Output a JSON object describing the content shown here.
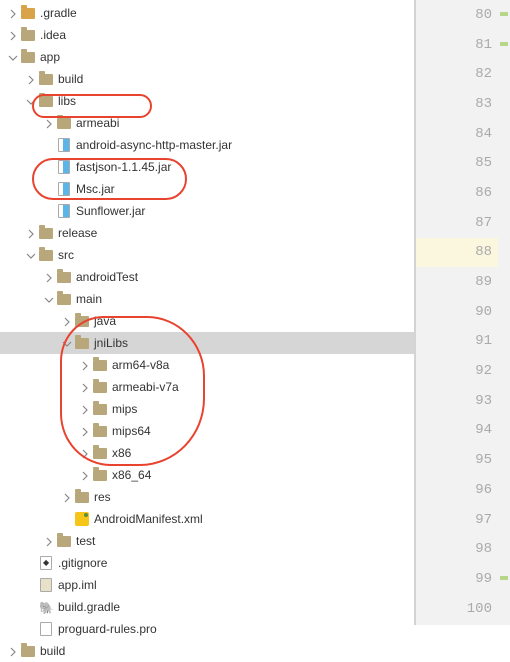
{
  "tree": [
    {
      "depth": 0,
      "arrow": "right",
      "icon": "folder-orange",
      "label": ".gradle"
    },
    {
      "depth": 0,
      "arrow": "right",
      "icon": "folder",
      "label": ".idea"
    },
    {
      "depth": 0,
      "arrow": "down",
      "icon": "folder",
      "label": "app"
    },
    {
      "depth": 1,
      "arrow": "right",
      "icon": "folder",
      "label": "build"
    },
    {
      "depth": 1,
      "arrow": "down",
      "icon": "folder",
      "label": "libs"
    },
    {
      "depth": 2,
      "arrow": "right",
      "icon": "folder",
      "label": "armeabi"
    },
    {
      "depth": 2,
      "arrow": "blank",
      "icon": "jar",
      "label": "android-async-http-master.jar"
    },
    {
      "depth": 2,
      "arrow": "blank",
      "icon": "jar",
      "label": "fastjson-1.1.45.jar"
    },
    {
      "depth": 2,
      "arrow": "blank",
      "icon": "jar",
      "label": "Msc.jar"
    },
    {
      "depth": 2,
      "arrow": "blank",
      "icon": "jar",
      "label": "Sunflower.jar"
    },
    {
      "depth": 1,
      "arrow": "right",
      "icon": "folder",
      "label": "release"
    },
    {
      "depth": 1,
      "arrow": "down",
      "icon": "folder",
      "label": "src"
    },
    {
      "depth": 2,
      "arrow": "right",
      "icon": "folder",
      "label": "androidTest"
    },
    {
      "depth": 2,
      "arrow": "down",
      "icon": "folder",
      "label": "main"
    },
    {
      "depth": 3,
      "arrow": "right",
      "icon": "folder",
      "label": "java"
    },
    {
      "depth": 3,
      "arrow": "down",
      "icon": "folder",
      "label": "jniLibs",
      "selected": true
    },
    {
      "depth": 4,
      "arrow": "right",
      "icon": "folder",
      "label": "arm64-v8a"
    },
    {
      "depth": 4,
      "arrow": "right",
      "icon": "folder",
      "label": "armeabi-v7a"
    },
    {
      "depth": 4,
      "arrow": "right",
      "icon": "folder",
      "label": "mips"
    },
    {
      "depth": 4,
      "arrow": "right",
      "icon": "folder",
      "label": "mips64"
    },
    {
      "depth": 4,
      "arrow": "right",
      "icon": "folder",
      "label": "x86"
    },
    {
      "depth": 4,
      "arrow": "right",
      "icon": "folder",
      "label": "x86_64"
    },
    {
      "depth": 3,
      "arrow": "right",
      "icon": "folder",
      "label": "res"
    },
    {
      "depth": 3,
      "arrow": "blank",
      "icon": "xml",
      "label": "AndroidManifest.xml"
    },
    {
      "depth": 2,
      "arrow": "right",
      "icon": "folder",
      "label": "test"
    },
    {
      "depth": 1,
      "arrow": "blank",
      "icon": "git",
      "label": ".gitignore"
    },
    {
      "depth": 1,
      "arrow": "blank",
      "icon": "iml",
      "label": "app.iml"
    },
    {
      "depth": 1,
      "arrow": "blank",
      "icon": "gradle",
      "label": "build.gradle"
    },
    {
      "depth": 1,
      "arrow": "blank",
      "icon": "file",
      "label": "proguard-rules.pro"
    },
    {
      "depth": 0,
      "arrow": "right",
      "icon": "folder",
      "label": "build"
    }
  ],
  "gutter": {
    "lines": [
      80,
      81,
      82,
      83,
      84,
      85,
      86,
      87,
      88,
      89,
      90,
      91,
      92,
      93,
      94,
      95,
      96,
      97,
      98,
      99,
      100
    ],
    "highlight": 88,
    "markers_at": [
      80,
      81,
      99
    ]
  }
}
